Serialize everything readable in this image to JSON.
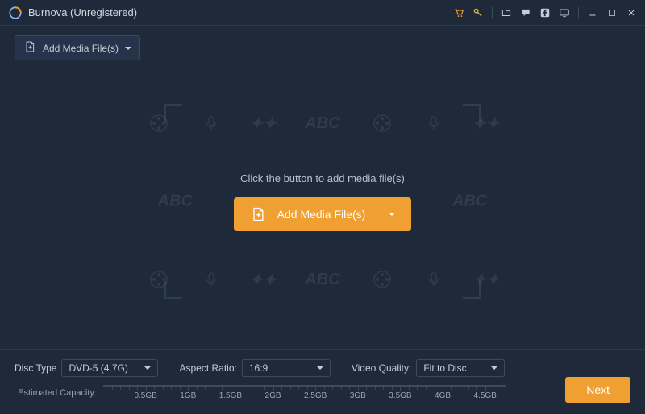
{
  "titlebar": {
    "title": "Burnova (Unregistered)"
  },
  "toolbar": {
    "add_media_label": "Add Media File(s)"
  },
  "center": {
    "hint": "Click the button to add media file(s)",
    "big_button_label": "Add Media File(s)",
    "bg_text": "ABC"
  },
  "settings": {
    "disc_type_label": "Disc Type",
    "disc_type_value": "DVD-5 (4.7G)",
    "aspect_ratio_label": "Aspect Ratio:",
    "aspect_ratio_value": "16:9",
    "video_quality_label": "Video Quality:",
    "video_quality_value": "Fit to Disc"
  },
  "capacity": {
    "label": "Estimated Capacity:",
    "ticks": [
      "0.5GB",
      "1GB",
      "1.5GB",
      "2GB",
      "2.5GB",
      "3GB",
      "3.5GB",
      "4GB",
      "4.5GB"
    ]
  },
  "buttons": {
    "next": "Next"
  }
}
